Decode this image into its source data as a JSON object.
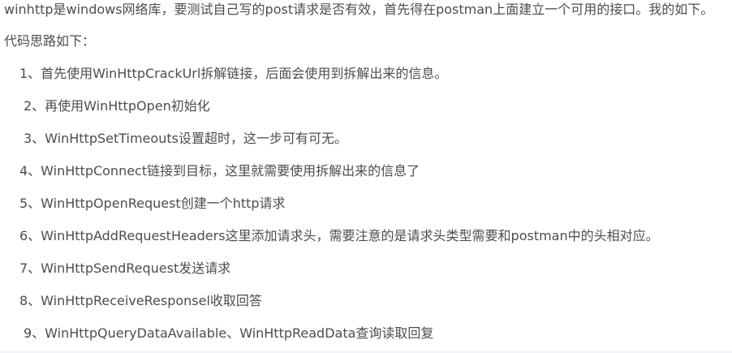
{
  "article": {
    "intro": "winhttp是windows网络库，要测试自己写的post请求是否有效，首先得在postman上面建立一个可用的接口。我的如下。",
    "lead": "代码思路如下：",
    "steps": [
      "1、首先使用WinHttpCrackUrl拆解链接，后面会使用到拆解出来的信息。",
      "2、再使用WinHttpOpen初始化",
      "3、WinHttpSetTimeouts设置超时，这一步可有可无。",
      "4、WinHttpConnect链接到目标，这里就需要使用拆解出来的信息了",
      "5、WinHttpOpenRequest创建一个http请求",
      "6、WinHttpAddRequestHeaders这里添加请求头，需要注意的是请求头类型需要和postman中的头相对应。",
      "7、WinHttpSendRequest发送请求",
      "8、WinHttpReceiveResponsel收取回答",
      "9、WinHttpQueryDataAvailable、WinHttpReadData查询读取回复"
    ]
  }
}
